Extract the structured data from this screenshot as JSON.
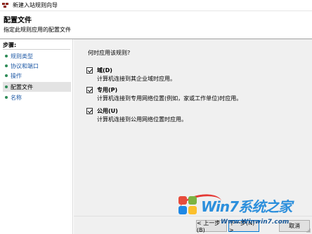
{
  "window": {
    "title": "新建入站规则向导",
    "icon": "firewall-icon"
  },
  "header": {
    "title": "配置文件",
    "subtitle": "指定此规则应用的配置文件"
  },
  "sidebar": {
    "title": "步骤:",
    "items": [
      {
        "label": "规则类型"
      },
      {
        "label": "协议和端口"
      },
      {
        "label": "操作"
      },
      {
        "label": "配置文件"
      },
      {
        "label": "名称"
      }
    ],
    "current_index": 3
  },
  "main": {
    "question": "何时应用该规则?",
    "options": [
      {
        "title": "域(D)",
        "description": "计算机连接到其企业域时应用。",
        "checked": true
      },
      {
        "title": "专用(P)",
        "description": "计算机连接到专用网络位置(例如，家或工作单位)时应用。",
        "checked": true
      },
      {
        "title": "公用(U)",
        "description": "计算机连接到公用网络位置时应用。",
        "checked": true
      }
    ]
  },
  "footer": {
    "back_label": "< 上一步(B)",
    "next_label": "下一步(N) >",
    "cancel_label": "取消"
  },
  "watermark": {
    "brand": "Win7系统之家",
    "url": "Www.Winwin7.com"
  },
  "colors": {
    "accent": "#0078d7",
    "link": "#1f5aa6",
    "step_dot": "#2e8b57",
    "content_bg": "#f0f0f0"
  }
}
